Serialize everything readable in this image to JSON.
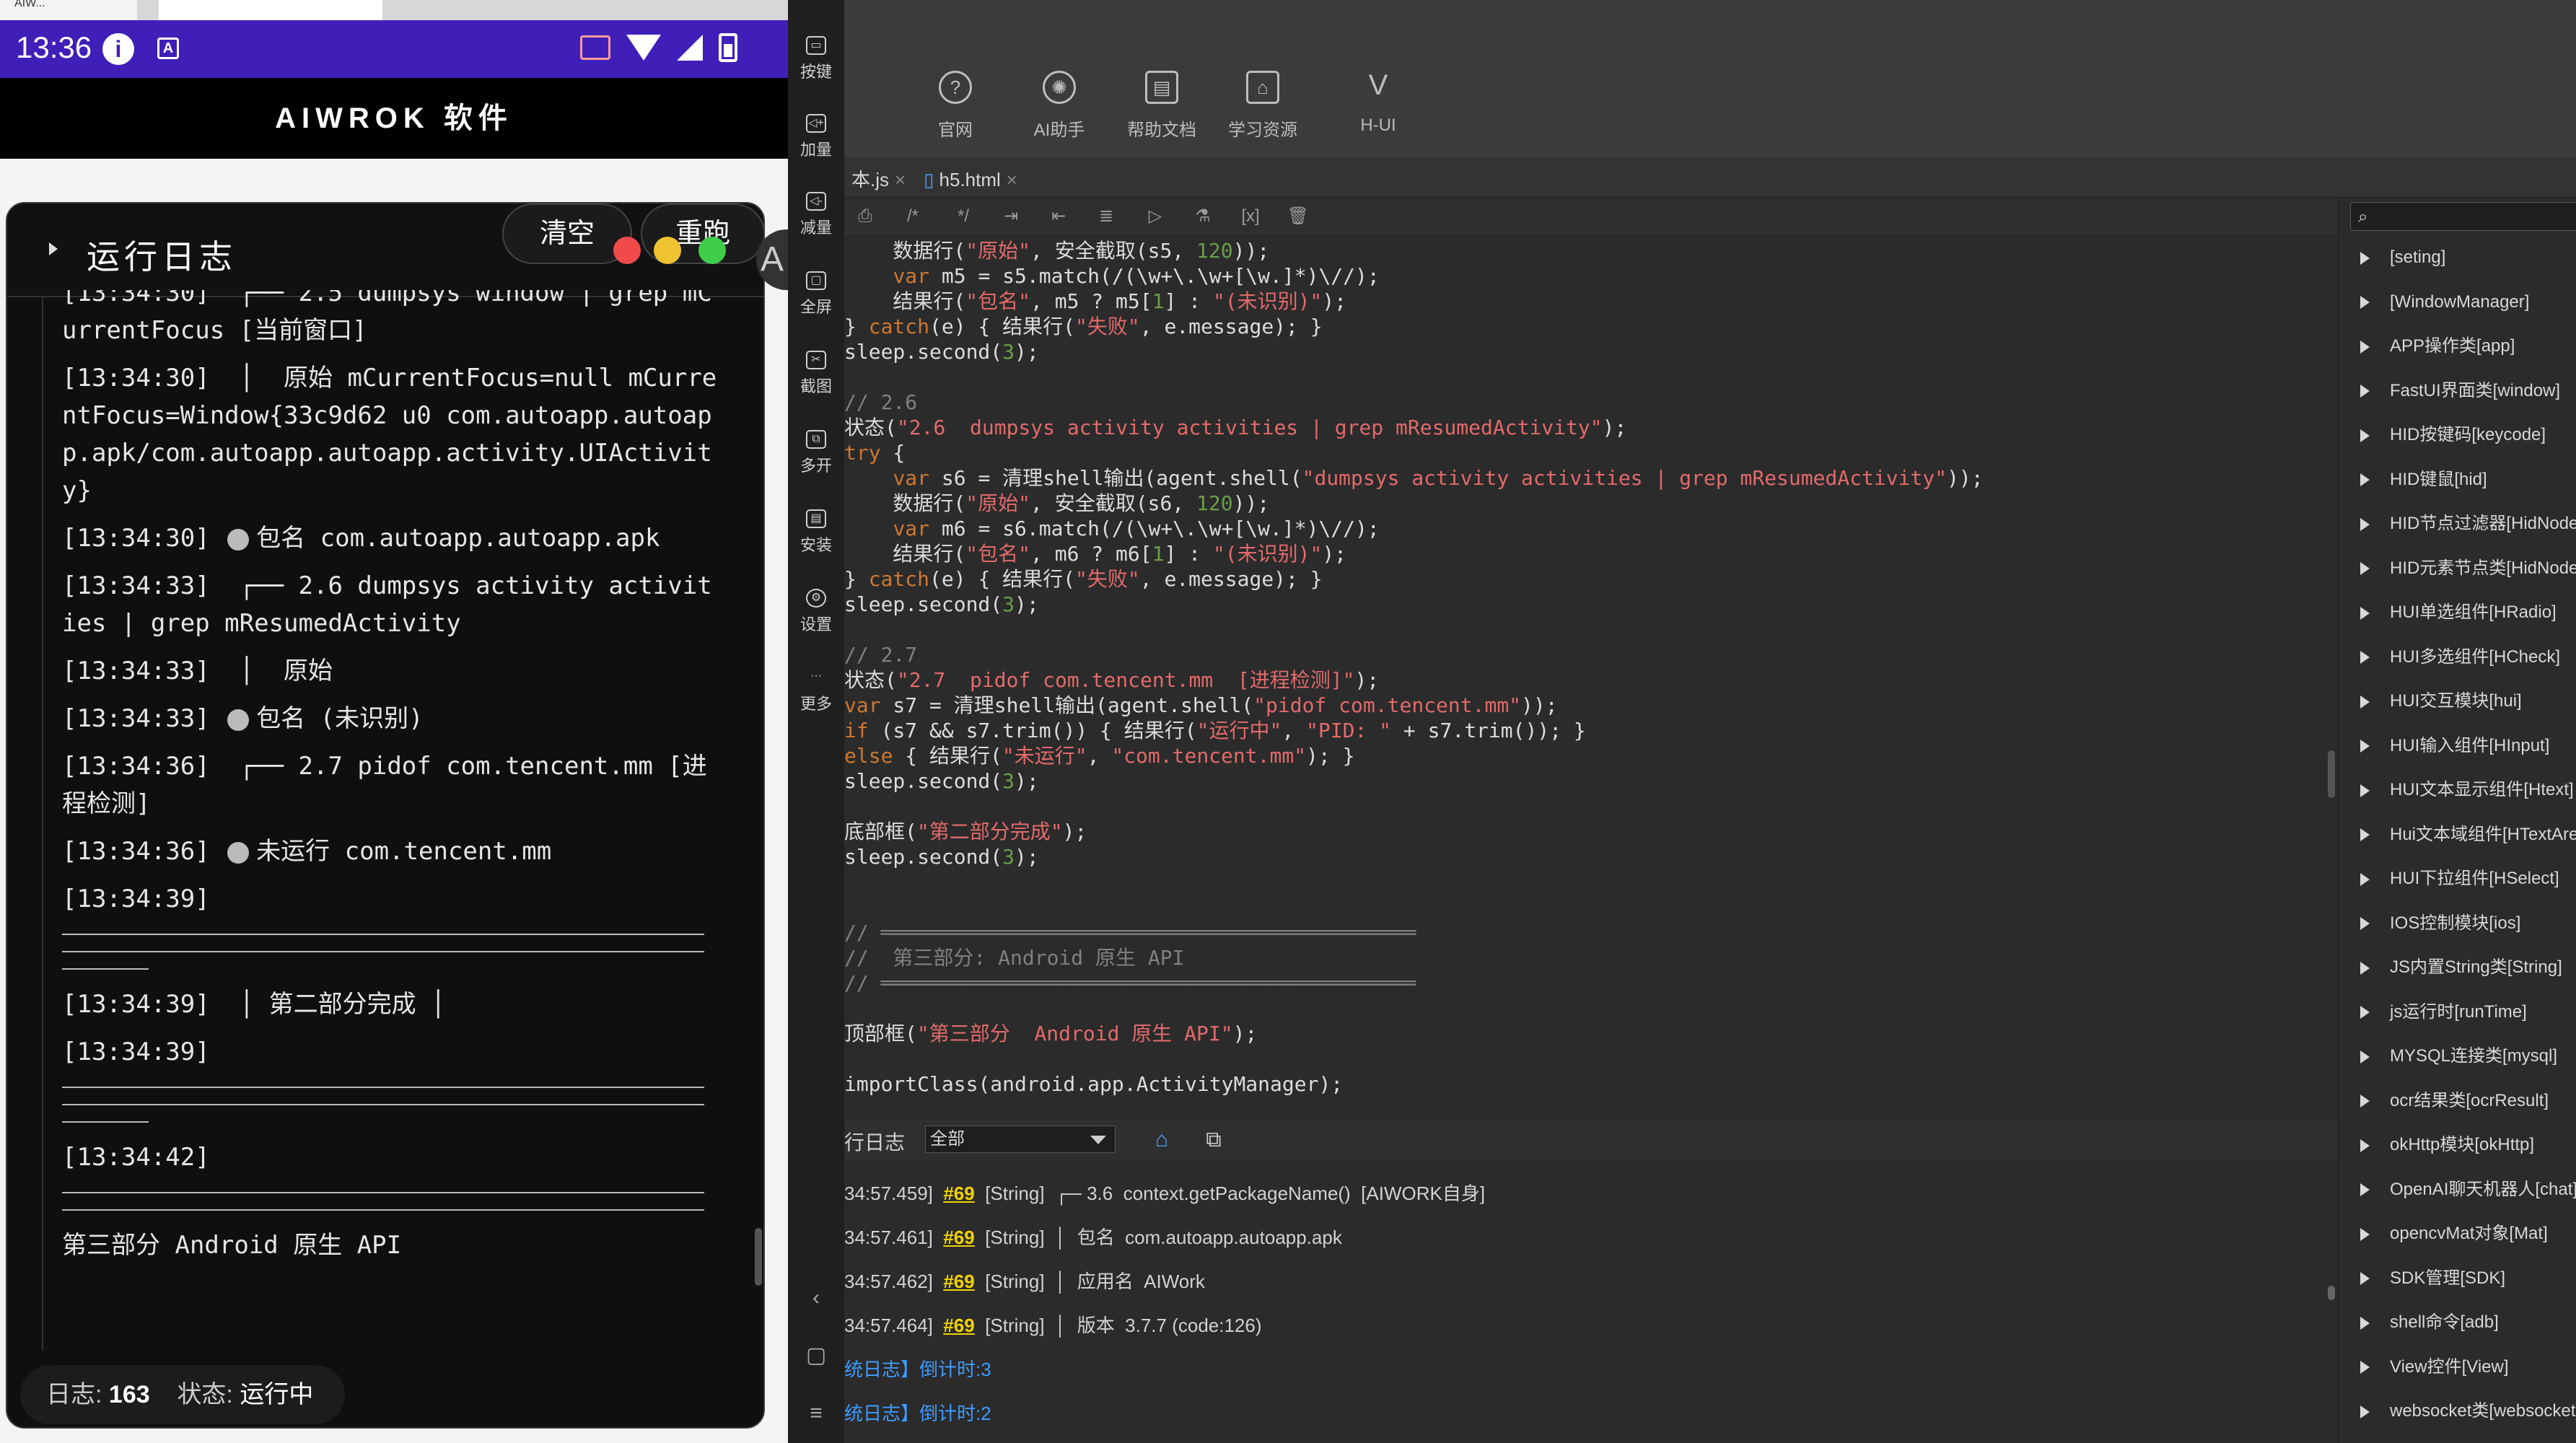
{
  "emulator": {
    "window_tab": "AIW..."
  },
  "status_bar": {
    "time": "13:36",
    "info_icon": "info-icon",
    "a_icon": "A"
  },
  "app": {
    "title": "AIWROK 软件"
  },
  "log_panel": {
    "title": "运行日志",
    "clear_label": "清空",
    "rerun_label": "重跑",
    "lines": [
      "[13:34:30]  ┌── 2.5 dumpsys window | grep mCurrentFocus [当前窗口]",
      "[13:34:30]  │  原始 mCurrentFocus=null mCurrentFocus=Window{33c9d62 u0 com.autoapp.autoapp.apk/com.autoapp.autoapp.activity.UIActivity}",
      "[13:34:30]",
      "包名 com.autoapp.autoapp.apk",
      "[13:34:33]  ┌── 2.6 dumpsys activity activities | grep mResumedActivity",
      "[13:34:33]  │  原始",
      "[13:34:33]",
      "包名 (未识别)",
      "[13:34:36]  ┌── 2.7 pidof com.tencent.mm [进程检测]",
      "[13:34:36]",
      "未运行 com.tencent.mm",
      "[13:34:39]",
      "[13:34:39]  │ 第二部分完成 │",
      "[13:34:39]",
      "[13:34:42]",
      "第三部分 Android 原生 API"
    ],
    "footer_log_label": "日志:",
    "footer_log_count": "163",
    "footer_state_label": "状态:",
    "footer_state_value": "运行中"
  },
  "vertical_bar": {
    "items": [
      "按键",
      "加量",
      "减量",
      "全屏",
      "截图",
      "多开",
      "安装",
      "设置",
      "更多"
    ]
  },
  "ide": {
    "toolbar": [
      "官网",
      "AI助手",
      "帮助文档",
      "学习资源",
      "H-UI"
    ],
    "tabs": [
      "本.js",
      "h5.html"
    ],
    "code": [
      "    数据行(\"原始\", 安全截取(s5, 120));",
      "    var m5 = s5.match(/(\\w+\\.\\w+[\\w.]*)\\//);",
      "    结果行(\"包名\", m5 ? m5[1] : \"(未识别)\");",
      "} catch(e) { 结果行(\"失败\", e.message); }",
      "sleep.second(3);",
      "",
      "// 2.6",
      "状态(\"2.6  dumpsys activity activities | grep mResumedActivity\");",
      "try {",
      "    var s6 = 清理shell输出(agent.shell(\"dumpsys activity activities | grep mResumedActivity\"));",
      "    数据行(\"原始\", 安全截取(s6, 120));",
      "    var m6 = s6.match(/(\\w+\\.\\w+[\\w.]*)\\//);",
      "    结果行(\"包名\", m6 ? m6[1] : \"(未识别)\");",
      "} catch(e) { 结果行(\"失败\", e.message); }",
      "sleep.second(3);",
      "",
      "// 2.7",
      "状态(\"2.7  pidof com.tencent.mm  [进程检测]\");",
      "var s7 = 清理shell输出(agent.shell(\"pidof com.tencent.mm\"));",
      "if (s7 && s7.trim()) { 结果行(\"运行中\", \"PID: \" + s7.trim()); }",
      "else { 结果行(\"未运行\", \"com.tencent.mm\"); }",
      "sleep.second(3);",
      "",
      "底部框(\"第二部分完成\");",
      "sleep.second(3);",
      "",
      "",
      "// ════════════════════════════════════════════",
      "//  第三部分: Android 原生 API",
      "// ════════════════════════════════════════════",
      "",
      "顶部框(\"第三部分  Android 原生 API\");",
      "",
      "importClass(android.app.ActivityManager);"
    ],
    "log_label": "行日志",
    "log_filter": "全部",
    "console": [
      {
        "ts": "34:57.459]",
        "ref": "#69",
        "type": "[String]",
        "msg": "┌─ 3.6  context.getPackageName()  [AIWORK自身]"
      },
      {
        "ts": "34:57.461]",
        "ref": "#69",
        "type": "[String]",
        "msg": "│  包名  com.autoapp.autoapp.apk"
      },
      {
        "ts": "34:57.462]",
        "ref": "#69",
        "type": "[String]",
        "msg": "│  应用名  AIWork"
      },
      {
        "ts": "34:57.464]",
        "ref": "#69",
        "type": "[String]",
        "msg": "│  版本  3.7.7 (code:126)"
      }
    ],
    "sys_lines": [
      "统日志】倒计时:3",
      "统日志】倒计时:2"
    ],
    "api_tree": [
      "[seting]",
      "[WindowManager]",
      "APP操作类[app]",
      "FastUI界面类[window]",
      "HID按键码[keycode]",
      "HID键鼠[hid]",
      "HID节点过滤器[HidNode]",
      "HID元素节点类[HidNode]",
      "HUI单选组件[HRadio]",
      "HUI多选组件[HCheck]",
      "HUI交互模块[hui]",
      "HUI输入组件[HInput]",
      "HUI文本显示组件[Htext]",
      "Hui文本域组件[HTextArea]",
      "HUI下拉组件[HSelect]",
      "IOS控制模块[ios]",
      "JS内置String类[String]",
      "js运行时[runTime]",
      "MYSQL连接类[mysql]",
      "ocr结果类[ocrResult]",
      "okHttp模块[okHttp]",
      "OpenAI聊天机器人[chat]",
      "opencvMat对象[Mat]",
      "SDK管理[SDK]",
      "shell命令[adb]",
      "View控件[View]",
      "websocket类[websocket]"
    ]
  }
}
